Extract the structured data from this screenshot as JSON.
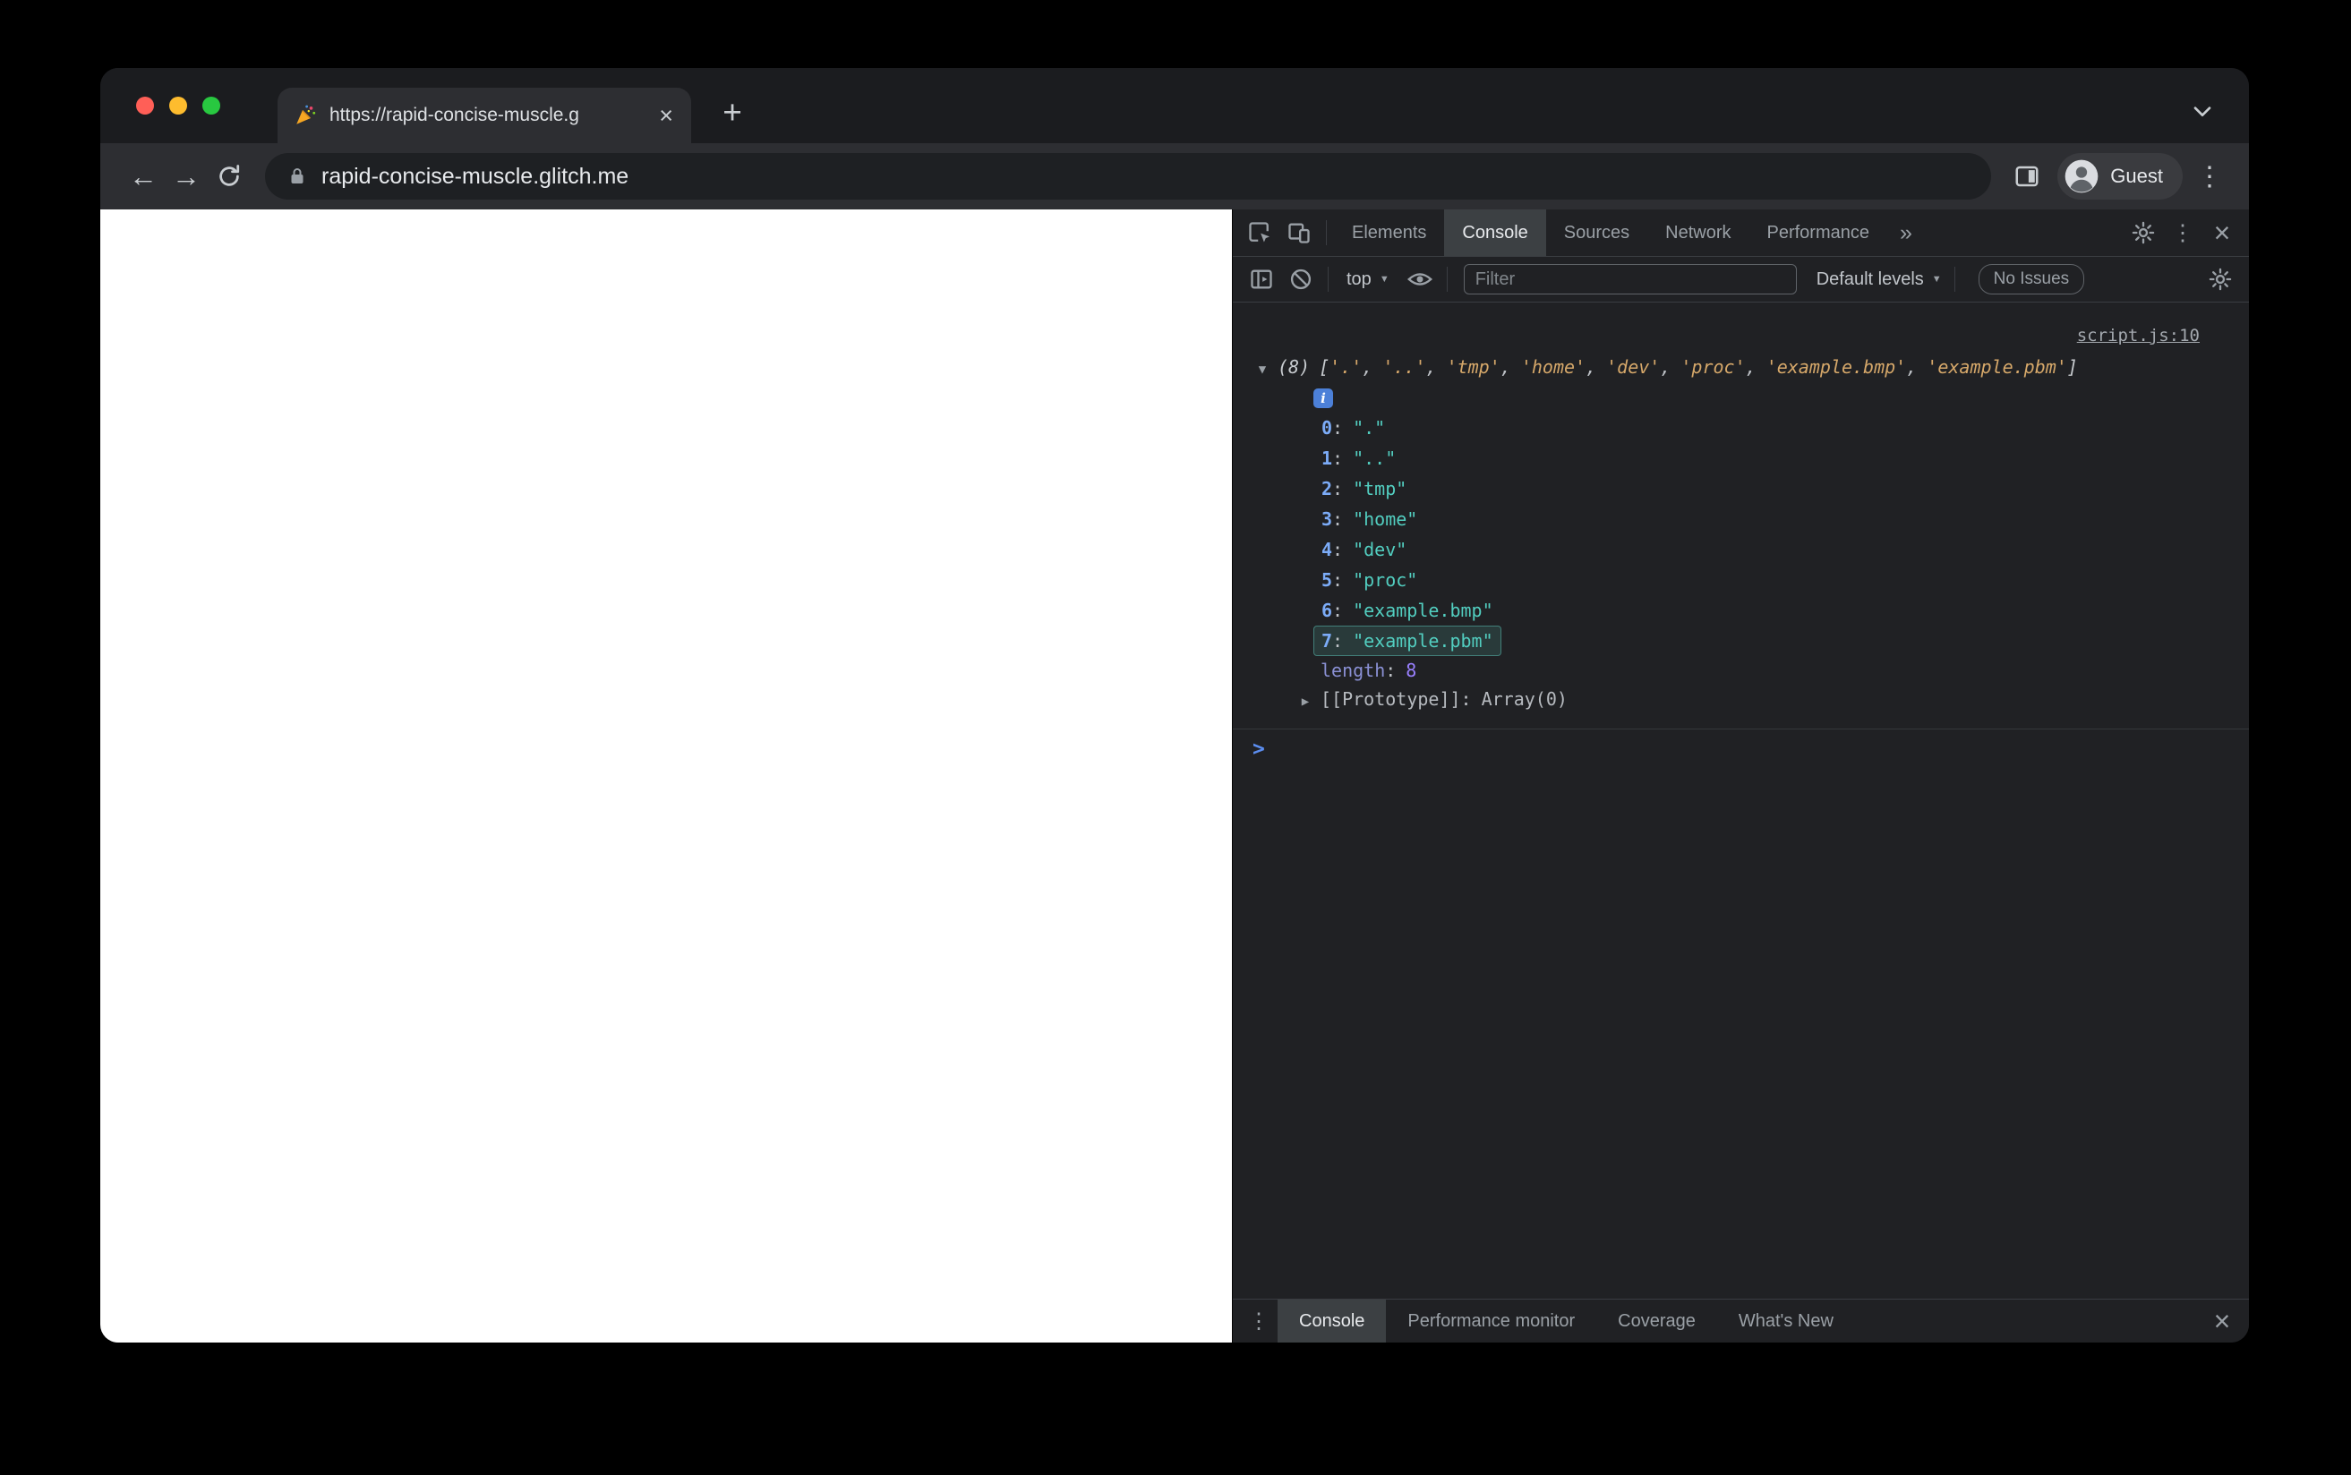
{
  "colors": {
    "accent_blue": "#7CACF8",
    "string_preview_orange": "#D6A86A",
    "string_value_teal": "#52CEC0",
    "number_violet": "#9980FF",
    "highlight_teal": "rgba(97,212,198,0.45)",
    "traffic_red": "#FF5F57",
    "traffic_yellow": "#FEBC2E",
    "traffic_green": "#28C840"
  },
  "browser": {
    "tab": {
      "title": "https://rapid-concise-muscle.g",
      "close_glyph": "×"
    },
    "new_tab_glyph": "+",
    "nav": {
      "back_glyph": "←",
      "forward_glyph": "→"
    },
    "omnibox": {
      "url": "rapid-concise-muscle.glitch.me"
    },
    "profile": {
      "label": "Guest"
    },
    "menu_glyph": "⋮"
  },
  "devtools": {
    "tabs": [
      {
        "label": "Elements",
        "active": false
      },
      {
        "label": "Console",
        "active": true
      },
      {
        "label": "Sources",
        "active": false
      },
      {
        "label": "Network",
        "active": false
      },
      {
        "label": "Performance",
        "active": false
      }
    ],
    "more_tabs_glyph": "»",
    "menu_glyph": "⋮",
    "close_glyph": "×",
    "toolbar": {
      "frame_label": "top",
      "drop_arrow_glyph": "▼",
      "filter_placeholder": "Filter",
      "levels_label": "Default levels",
      "issues_label": "No Issues"
    },
    "console": {
      "source_link": "script.js:10",
      "expand_open_glyph": "▼",
      "expand_closed_glyph": "▶",
      "colon_glyph": ":",
      "comma_glyph": ",",
      "array_preview": {
        "count": "(8)",
        "open_bracket": "[",
        "close_bracket": "]",
        "items": [
          "'.'",
          "'..'",
          "'tmp'",
          "'home'",
          "'dev'",
          "'proc'",
          "'example.bmp'",
          "'example.pbm'"
        ]
      },
      "info_badge": "i",
      "entries": [
        {
          "index": "0",
          "value": "\".\"",
          "highlight": false
        },
        {
          "index": "1",
          "value": "\"..\"",
          "highlight": false
        },
        {
          "index": "2",
          "value": "\"tmp\"",
          "highlight": false
        },
        {
          "index": "3",
          "value": "\"home\"",
          "highlight": false
        },
        {
          "index": "4",
          "value": "\"dev\"",
          "highlight": false
        },
        {
          "index": "5",
          "value": "\"proc\"",
          "highlight": false
        },
        {
          "index": "6",
          "value": "\"example.bmp\"",
          "highlight": false
        },
        {
          "index": "7",
          "value": "\"example.pbm\"",
          "highlight": true
        }
      ],
      "length_label": "length",
      "length_value": "8",
      "prototype_label": "[[Prototype]]",
      "prototype_value": "Array(0)",
      "prompt_glyph": ">"
    },
    "drawer": {
      "menu_glyph": "⋮",
      "tabs": [
        {
          "label": "Console",
          "active": true
        },
        {
          "label": "Performance monitor",
          "active": false
        },
        {
          "label": "Coverage",
          "active": false
        },
        {
          "label": "What's New",
          "active": false
        }
      ],
      "close_glyph": "×"
    }
  }
}
